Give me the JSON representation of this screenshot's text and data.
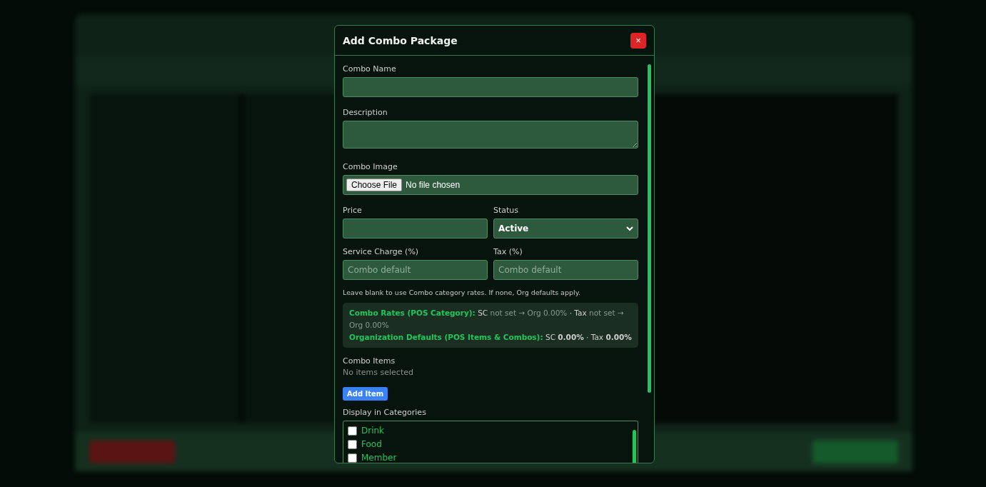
{
  "modal": {
    "title": "Add Combo Package",
    "close": "×",
    "fields": [
      {
        "kind": "text",
        "label": "Combo Name"
      },
      {
        "kind": "textarea",
        "label": "Description"
      },
      {
        "kind": "file",
        "label": "Combo Image",
        "button": "Choose File",
        "value": "No file chosen"
      }
    ],
    "price": {
      "label": "Price"
    },
    "status": {
      "label": "Status",
      "value": "Active"
    },
    "service_charge": {
      "label": "Service Charge (%)",
      "placeholder": "Combo default"
    },
    "tax": {
      "label": "Tax (%)",
      "placeholder": "Combo default"
    },
    "hint": "Leave blank to use Combo category rates. If none, Org defaults apply.",
    "rates_info": [
      {
        "label": "Combo Rates (POS Category):",
        "text": "SC *not set → Org 0.00%* · Tax *not set → Org 0.00%*"
      },
      {
        "label": "Organization Defaults (POS Items & Combos):",
        "text": "SC **0.00%** · Tax **0.00%**"
      }
    ],
    "combo_items": {
      "label": "Combo Items",
      "empty_text": "No items selected",
      "button": "Add Item"
    },
    "categories": {
      "label": "Display in Categories",
      "items": [
        {
          "label": "Drink",
          "checked": false
        },
        {
          "label": "Food",
          "checked": false
        },
        {
          "label": "Member",
          "checked": false
        }
      ]
    }
  }
}
